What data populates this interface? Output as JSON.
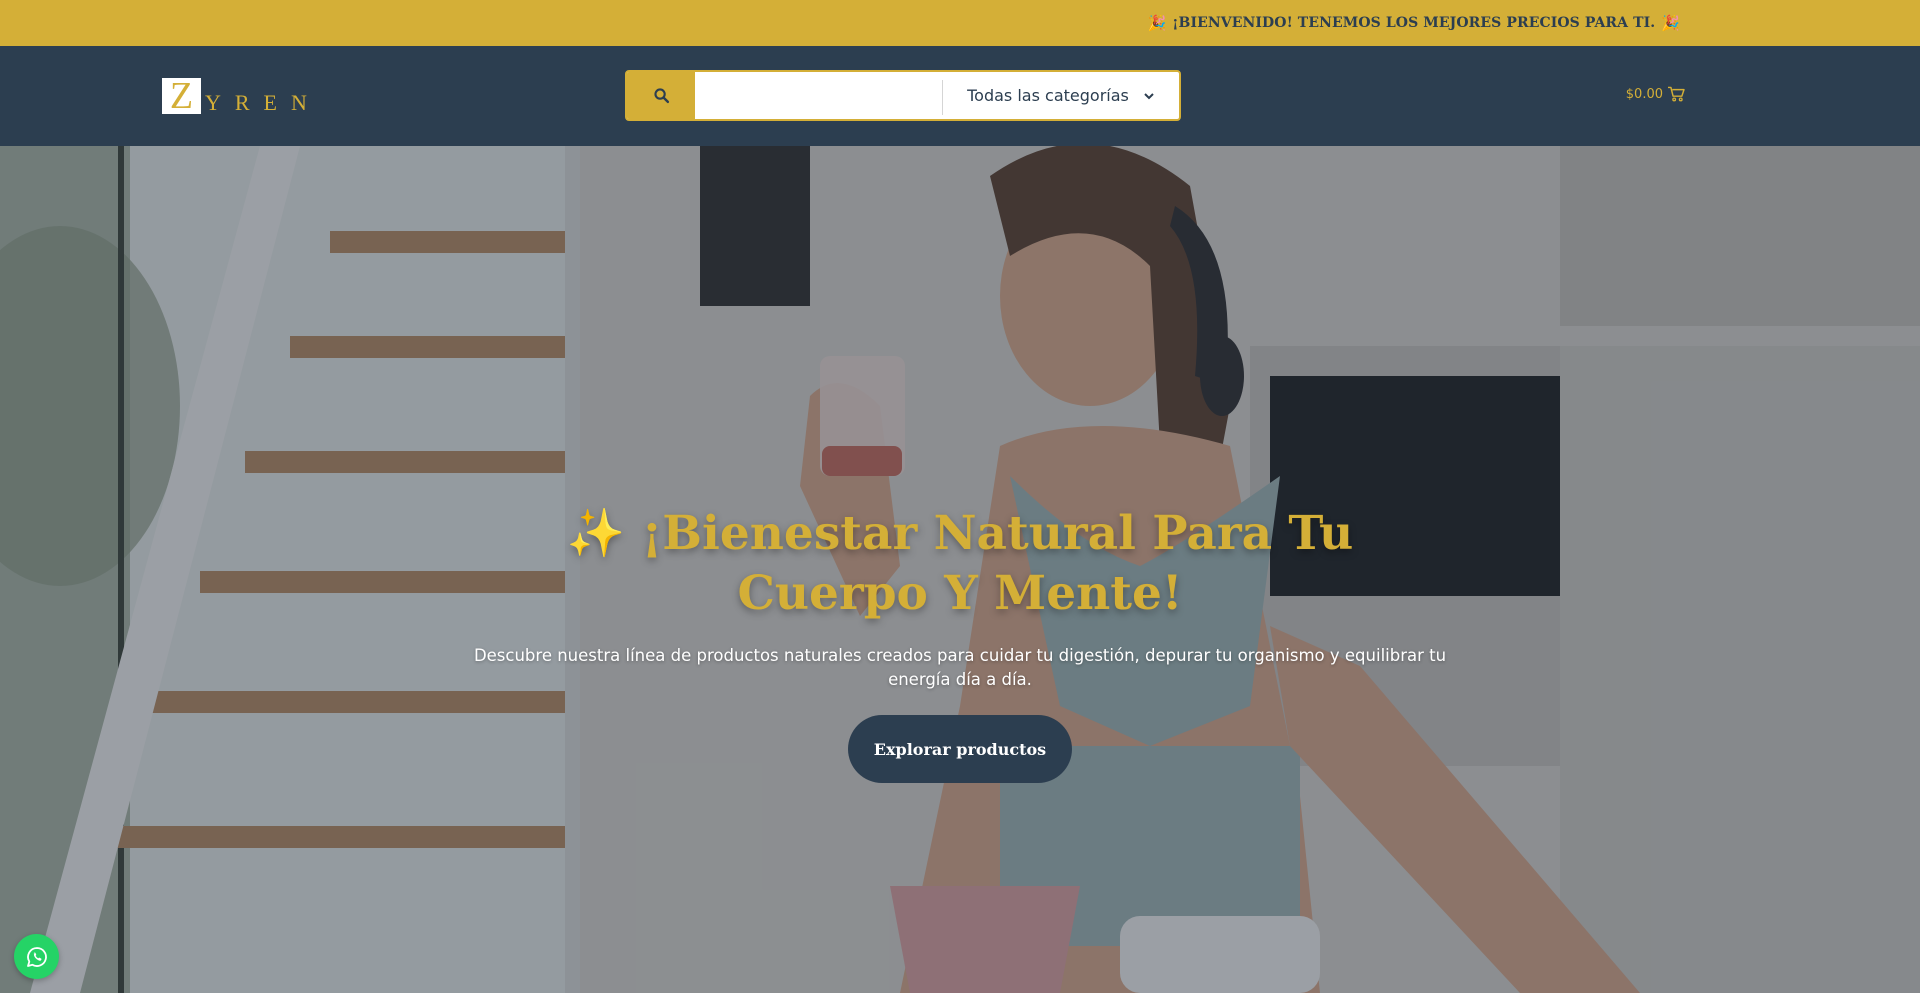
{
  "announcement": {
    "text": "¡BIENVENIDO! TENEMOS LOS MEJORES PRECIOS PARA TI.",
    "emoji": "🎉"
  },
  "header": {
    "logo": {
      "initial": "Z",
      "rest": "YREN"
    },
    "search": {
      "value": "",
      "placeholder": "",
      "category": "Todas las categorías"
    },
    "cart": {
      "total": "$0.00"
    }
  },
  "hero": {
    "title_emoji": "✨",
    "title": "¡Bienestar Natural Para Tu Cuerpo Y Mente!",
    "subtitle": "Descubre nuestra línea de productos naturales creados para cuidar tu digestión, depurar tu organismo y equilibrar tu energía día a día.",
    "cta": "Explorar productos"
  },
  "colors": {
    "gold": "#d4af37",
    "navy": "#2c3e50",
    "whatsapp": "#25d366"
  },
  "icons": {
    "search": "search-icon",
    "dropdown": "chevron-down-icon",
    "cart": "cart-icon",
    "whatsapp": "whatsapp-icon"
  }
}
